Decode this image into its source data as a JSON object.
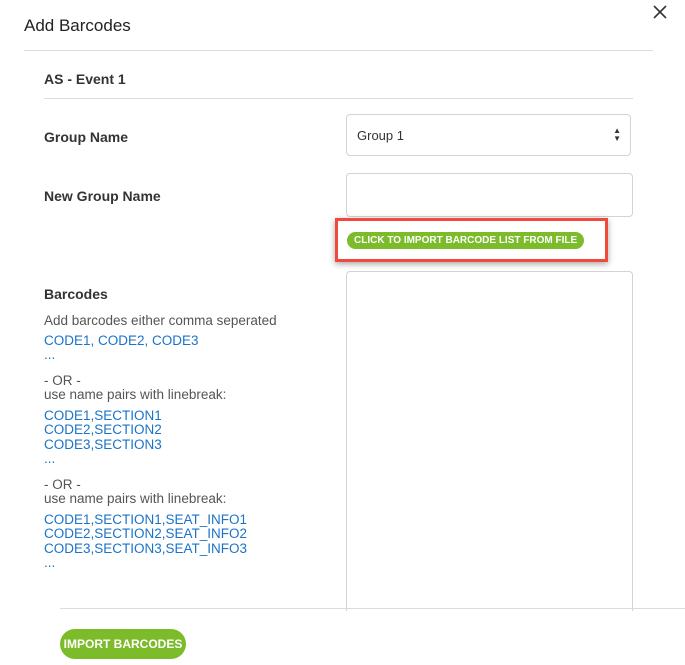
{
  "modal": {
    "title": "Add Barcodes",
    "close_icon": "close-icon"
  },
  "event": {
    "name": "AS - Event 1"
  },
  "form": {
    "group_name_label": "Group Name",
    "group_name_value": "Group 1",
    "new_group_name_label": "New Group Name",
    "new_group_name_value": "",
    "import_file_button": "CLICK TO IMPORT BARCODE LIST FROM FILE",
    "barcodes_label": "Barcodes",
    "barcodes_value": ""
  },
  "help": {
    "intro": "Add barcodes either comma seperated",
    "example1": "CODE1, CODE2, CODE3",
    "ellipsis1": "...",
    "or1": "- OR -",
    "pairs_intro1": "use name pairs with linebreak:",
    "example2": [
      "CODE1,SECTION1",
      "CODE2,SECTION2",
      "CODE3,SECTION3"
    ],
    "ellipsis2": "...",
    "or2": "- OR -",
    "pairs_intro2": "use name pairs with linebreak:",
    "example3": [
      "CODE1,SECTION1,SEAT_INFO1",
      "CODE2,SECTION2,SEAT_INFO2",
      "CODE3,SECTION3,SEAT_INFO3"
    ],
    "ellipsis3": "..."
  },
  "footer": {
    "import_button": "IMPORT BARCODES"
  },
  "colors": {
    "accent_green": "#7cbb2a",
    "highlight_red": "#f04a3c",
    "link_blue": "#1a73c8"
  }
}
